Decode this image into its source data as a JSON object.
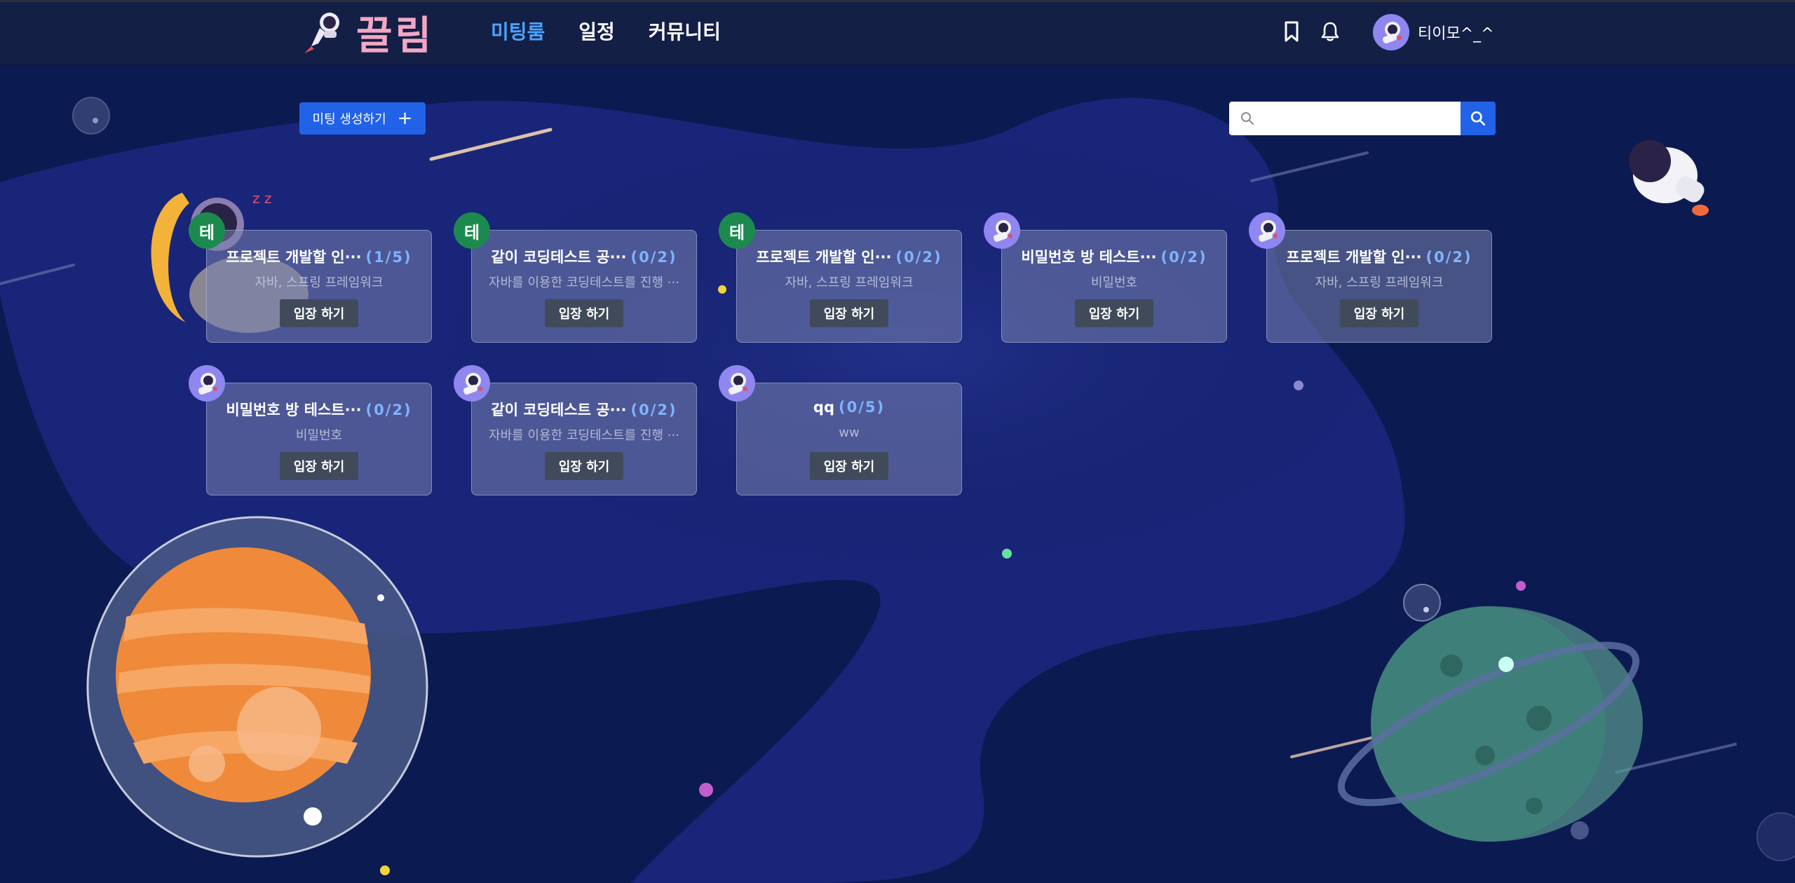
{
  "header": {
    "logo_text": "끌림",
    "nav": [
      {
        "label": "미팅룸",
        "active": true
      },
      {
        "label": "일정",
        "active": false
      },
      {
        "label": "커뮤니티",
        "active": false
      }
    ],
    "icons": [
      "bookmark-icon",
      "bell-icon"
    ],
    "user_name": "티이모^_^"
  },
  "toolbar": {
    "create_label": "미팅 생성하기",
    "create_icon": "plus-icon",
    "search_placeholder": "",
    "search_icon": "search-icon"
  },
  "rooms": [
    {
      "badge": "테",
      "badge_type": "text",
      "title": "프로젝트 개발할 인···",
      "count": "(1/5)",
      "subtitle": "자바, 스프링 프레임워크",
      "button": "입장 하기"
    },
    {
      "badge": "테",
      "badge_type": "text",
      "title": "같이 코딩테스트 공···",
      "count": "(0/2)",
      "subtitle": "자바를 이용한 코딩테스트를 진행 ···",
      "button": "입장 하기"
    },
    {
      "badge": "테",
      "badge_type": "text",
      "title": "프로젝트 개발할 인···",
      "count": "(0/2)",
      "subtitle": "자바, 스프링 프레임워크",
      "button": "입장 하기"
    },
    {
      "badge": "",
      "badge_type": "img",
      "title": "비밀번호 방 테스트···",
      "count": "(0/2)",
      "subtitle": "비밀번호",
      "button": "입장 하기"
    },
    {
      "badge": "",
      "badge_type": "img",
      "title": "프로젝트 개발할 인···",
      "count": "(0/2)",
      "subtitle": "자바, 스프링 프레임워크",
      "button": "입장 하기"
    },
    {
      "badge": "",
      "badge_type": "img",
      "title": "비밀번호 방 테스트···",
      "count": "(0/2)",
      "subtitle": "비밀번호",
      "button": "입장 하기"
    },
    {
      "badge": "",
      "badge_type": "img",
      "title": "같이 코딩테스트 공···",
      "count": "(0/2)",
      "subtitle": "자바를 이용한 코딩테스트를 진행 ···",
      "button": "입장 하기"
    },
    {
      "badge": "",
      "badge_type": "img",
      "title": "qq",
      "count": "(0/5)",
      "subtitle": "ww",
      "button": "입장 하기"
    }
  ],
  "colors": {
    "background": "#0c1a52",
    "header": "#141f45",
    "accent": "#2162e6",
    "nav_active": "#4da3ff",
    "count_text": "#7fb3ff",
    "badge_green": "#1c8a4e",
    "badge_purple": "#8f86f0"
  }
}
